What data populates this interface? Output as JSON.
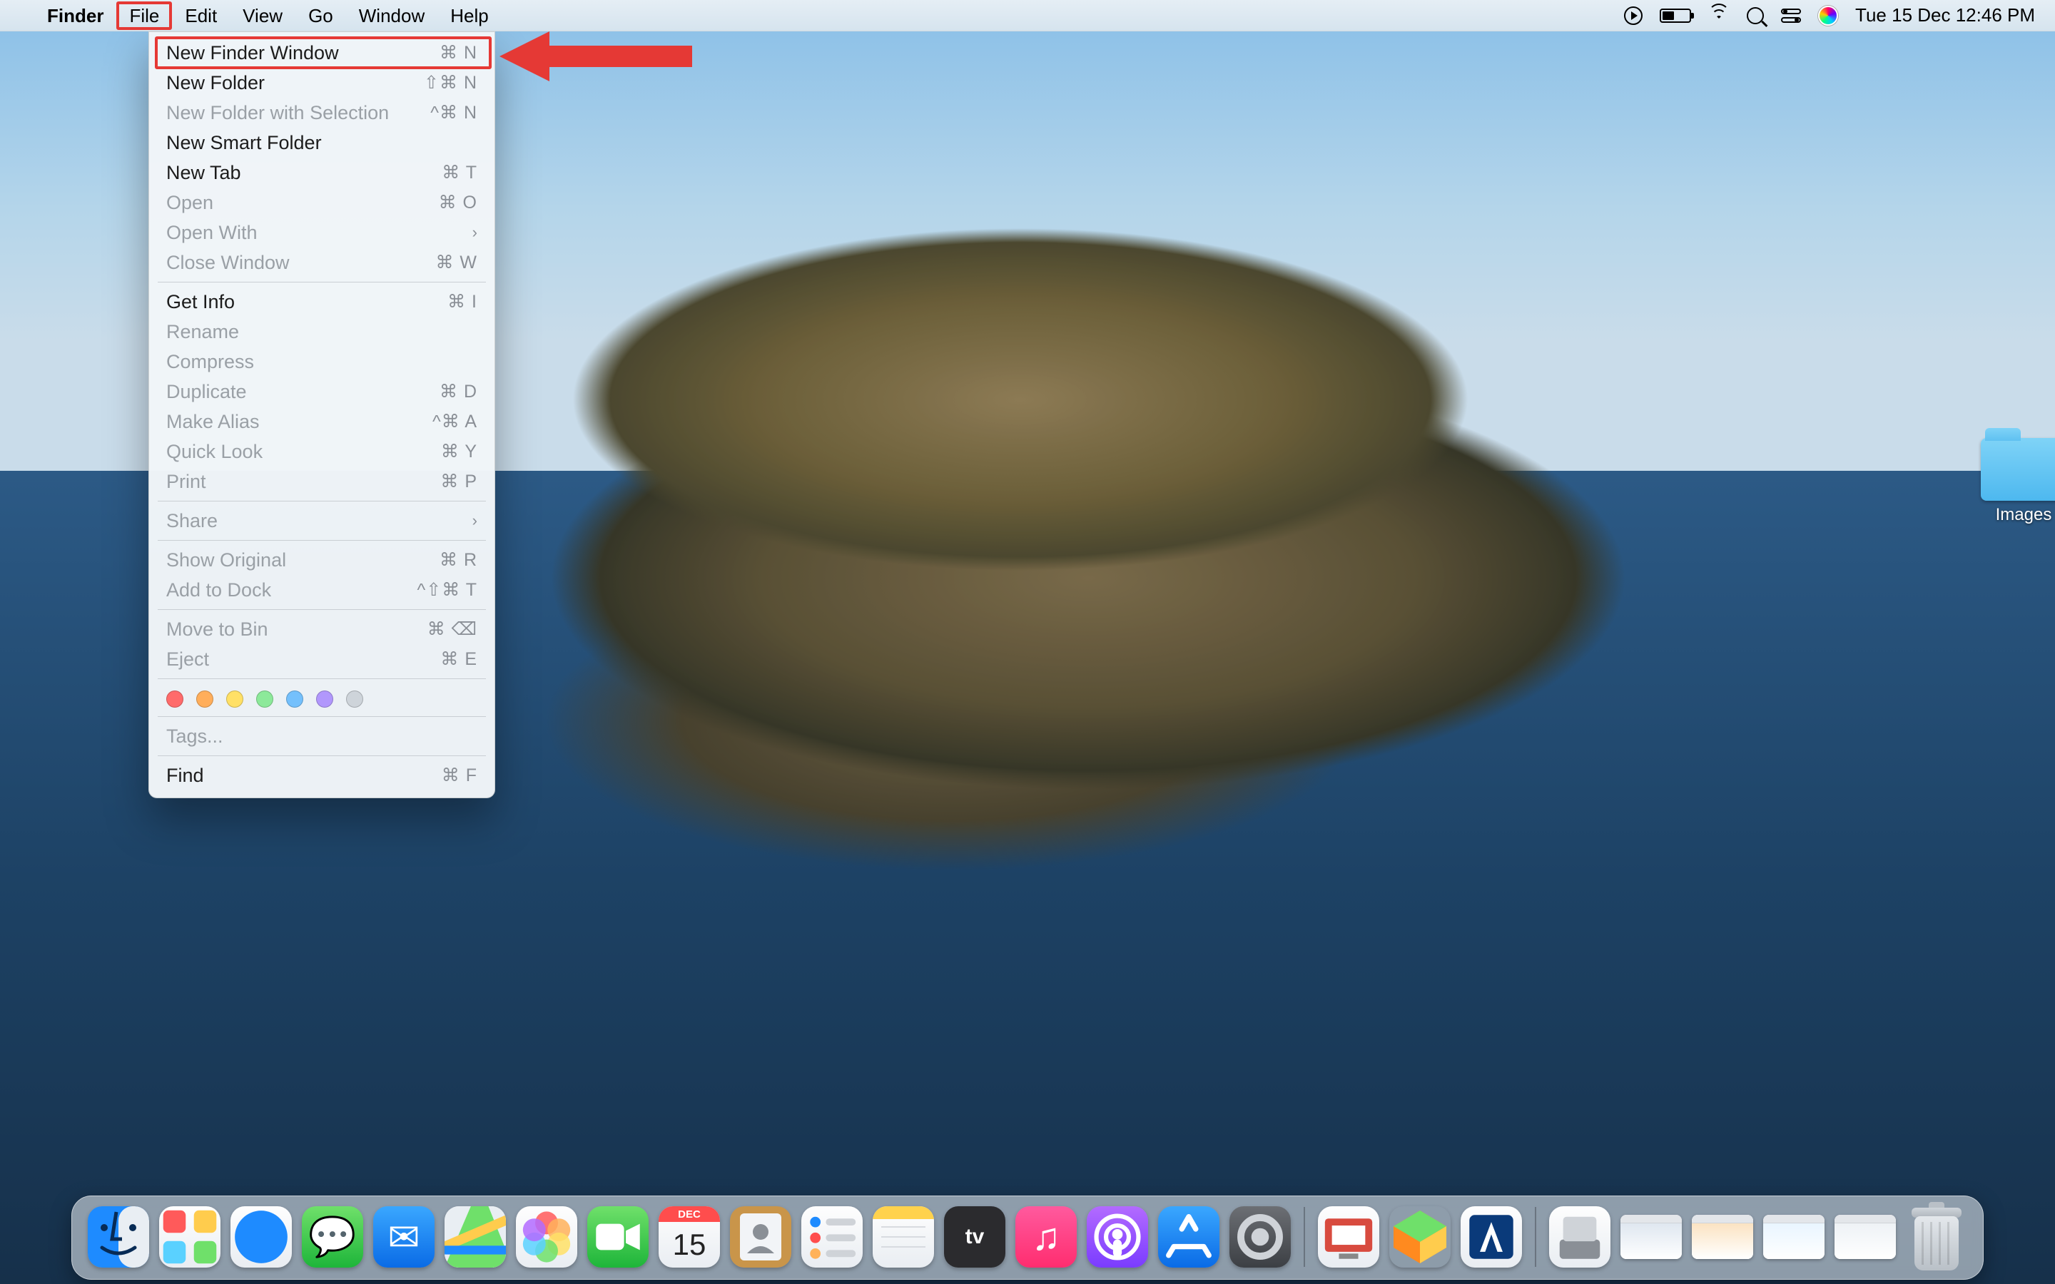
{
  "menubar": {
    "app_name": "Finder",
    "items": [
      "File",
      "Edit",
      "View",
      "Go",
      "Window",
      "Help"
    ],
    "active_menu_index": 0,
    "clock": "Tue 15 Dec  12:46 PM"
  },
  "file_menu": {
    "groups": [
      [
        {
          "label": "New Finder Window",
          "shortcut": "⌘ N",
          "enabled": true,
          "highlight": true
        },
        {
          "label": "New Folder",
          "shortcut": "⇧⌘ N",
          "enabled": true
        },
        {
          "label": "New Folder with Selection",
          "shortcut": "^⌘ N",
          "enabled": false
        },
        {
          "label": "New Smart Folder",
          "shortcut": "",
          "enabled": true
        },
        {
          "label": "New Tab",
          "shortcut": "⌘ T",
          "enabled": true
        },
        {
          "label": "Open",
          "shortcut": "⌘ O",
          "enabled": false
        },
        {
          "label": "Open With",
          "submenu": true,
          "enabled": false
        },
        {
          "label": "Close Window",
          "shortcut": "⌘ W",
          "enabled": false
        }
      ],
      [
        {
          "label": "Get Info",
          "shortcut": "⌘ I",
          "enabled": true
        },
        {
          "label": "Rename",
          "shortcut": "",
          "enabled": false
        },
        {
          "label": "Compress",
          "shortcut": "",
          "enabled": false
        },
        {
          "label": "Duplicate",
          "shortcut": "⌘ D",
          "enabled": false
        },
        {
          "label": "Make Alias",
          "shortcut": "^⌘ A",
          "enabled": false
        },
        {
          "label": "Quick Look",
          "shortcut": "⌘ Y",
          "enabled": false
        },
        {
          "label": "Print",
          "shortcut": "⌘ P",
          "enabled": false
        }
      ],
      [
        {
          "label": "Share",
          "submenu": true,
          "enabled": false
        }
      ],
      [
        {
          "label": "Show Original",
          "shortcut": "⌘ R",
          "enabled": false
        },
        {
          "label": "Add to Dock",
          "shortcut": "^⇧⌘ T",
          "enabled": false
        }
      ],
      [
        {
          "label": "Move to Bin",
          "shortcut": "⌘ ⌫",
          "enabled": false
        },
        {
          "label": "Eject",
          "shortcut": "⌘ E",
          "enabled": false
        }
      ],
      [
        {
          "tags_row": true
        }
      ],
      [
        {
          "label": "Tags...",
          "enabled": false
        }
      ],
      [
        {
          "label": "Find",
          "shortcut": "⌘ F",
          "enabled": true
        }
      ]
    ],
    "tag_colors": [
      "red",
      "orange",
      "yellow",
      "green",
      "blue",
      "purple",
      "gray"
    ]
  },
  "desktop_icons": [
    {
      "name": "Images",
      "kind": "folder"
    }
  ],
  "dock": {
    "apps": [
      {
        "name": "finder"
      },
      {
        "name": "launchpad"
      },
      {
        "name": "safari"
      },
      {
        "name": "messages"
      },
      {
        "name": "mail"
      },
      {
        "name": "maps"
      },
      {
        "name": "photos"
      },
      {
        "name": "facetime"
      },
      {
        "name": "calendar",
        "badge_month": "DEC",
        "badge_day": "15"
      },
      {
        "name": "contacts"
      },
      {
        "name": "reminders"
      },
      {
        "name": "notes"
      },
      {
        "name": "tv"
      },
      {
        "name": "music"
      },
      {
        "name": "podcasts"
      },
      {
        "name": "appstore"
      },
      {
        "name": "settings"
      }
    ],
    "extras": [
      {
        "name": "anydesk"
      },
      {
        "name": "swift-playgrounds"
      },
      {
        "name": "virtualbox"
      }
    ],
    "tray": [
      {
        "name": "downloads-stack"
      },
      {
        "name": "minimized-window-1"
      },
      {
        "name": "minimized-window-2"
      },
      {
        "name": "minimized-window-3"
      },
      {
        "name": "minimized-window-4"
      },
      {
        "name": "trash"
      }
    ]
  },
  "annotation": {
    "arrow_points_to": "file_menu.groups.0.0"
  }
}
